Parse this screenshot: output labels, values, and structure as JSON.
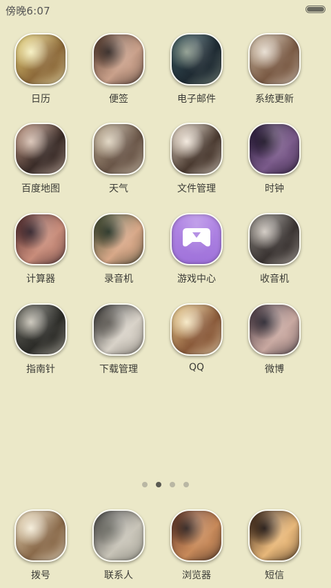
{
  "status_bar": {
    "time": "傍晚6:07"
  },
  "apps": [
    {
      "label": "日历",
      "colors": [
        "#e7d27a",
        "#8d6a3a",
        "#f6f0c0"
      ]
    },
    {
      "label": "便签",
      "colors": [
        "#5a3e30",
        "#c9a08a",
        "#2b201c"
      ]
    },
    {
      "label": "电子邮件",
      "colors": [
        "#3a5860",
        "#1f2b33",
        "#8c9a8c"
      ]
    },
    {
      "label": "系统更新",
      "colors": [
        "#c9b7a0",
        "#7a5a44",
        "#e7ddd0"
      ]
    },
    {
      "label": "百度地图",
      "colors": [
        "#c49a86",
        "#3a2c28",
        "#d8c2b4"
      ]
    },
    {
      "label": "天气",
      "colors": [
        "#b8a890",
        "#6a5648",
        "#dfd4c0"
      ]
    },
    {
      "label": "文件管理",
      "colors": [
        "#e0d2c2",
        "#4a3a30",
        "#f2e8dc"
      ]
    },
    {
      "label": "时钟",
      "colors": [
        "#2c1f3c",
        "#7a5a8a",
        "#180f22"
      ]
    },
    {
      "label": "计算器",
      "colors": [
        "#5a3030",
        "#c88c7a",
        "#2a1a22"
      ]
    },
    {
      "label": "录音机",
      "colors": [
        "#3a4a30",
        "#d8a888",
        "#1e2a1c"
      ]
    },
    {
      "label": "游戏中心",
      "colors": [
        "#b48ae6",
        "#9f72da",
        "#ffffff"
      ]
    },
    {
      "label": "收音机",
      "colors": [
        "#8a8680",
        "#3a3432",
        "#cfc8c0"
      ]
    },
    {
      "label": "指南针",
      "colors": [
        "#6a6a62",
        "#2c2c28",
        "#c8c4b8"
      ]
    },
    {
      "label": "下载管理",
      "colors": [
        "#1c1c1c",
        "#d8d2c8",
        "#5a5650"
      ]
    },
    {
      "label": "QQ",
      "colors": [
        "#e8c88a",
        "#8a5a3a",
        "#f6e8c4"
      ]
    },
    {
      "label": "微博",
      "colors": [
        "#4a3a44",
        "#c8a8a0",
        "#24202a"
      ]
    }
  ],
  "dock": [
    {
      "label": "拨号",
      "colors": [
        "#e8d8b8",
        "#8a6a4a",
        "#f4ecd8"
      ]
    },
    {
      "label": "联系人",
      "colors": [
        "#3a3a3a",
        "#c8c4b8",
        "#6a6a62"
      ]
    },
    {
      "label": "浏览器",
      "colors": [
        "#6a3a2a",
        "#c88a5a",
        "#2a1c18"
      ]
    },
    {
      "label": "短信",
      "colors": [
        "#3a2418",
        "#e8b87a",
        "#1a0f0a"
      ]
    }
  ],
  "page_indicator": {
    "count": 4,
    "active": 2
  }
}
